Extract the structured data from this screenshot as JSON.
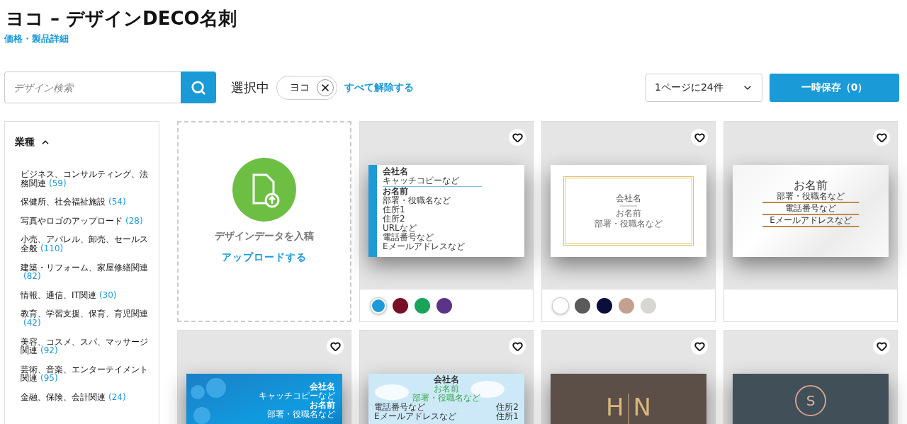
{
  "header": {
    "title": "ヨコ – デザインDECO名刺",
    "link": "価格・製品詳細"
  },
  "search": {
    "placeholder": "デザイン検索"
  },
  "filter": {
    "label": "選択中",
    "chips": [
      {
        "label": "ヨコ"
      }
    ],
    "clear_all": "すべて解除する"
  },
  "per_page": {
    "value": "1ページに24件"
  },
  "save_button": "一時保存（0）",
  "sidebar": {
    "heading": "業種",
    "expanded": true,
    "items": [
      {
        "label": "ビジネス、コンサルティング、法務関連",
        "count": "(59)"
      },
      {
        "label": "保健所、社会福祉施設",
        "count": "(54)"
      },
      {
        "label": "写真やロゴのアップロード",
        "count": "(28)"
      },
      {
        "label": "小売、アパレル、卸売、セールス全般",
        "count": "(110)"
      },
      {
        "label": "建築・リフォーム、家屋修繕関連",
        "count": "(82)"
      },
      {
        "label": "情報、通信、IT関連",
        "count": "(30)"
      },
      {
        "label": "教育、学習支援、保育、育児関連",
        "count": "(42)"
      },
      {
        "label": "美容、コスメ、スパ、マッサージ関連",
        "count": "(92)"
      },
      {
        "label": "芸術、音楽、エンターテイメント関連",
        "count": "(95)"
      },
      {
        "label": "金融、保険、会計関連",
        "count": "(24)"
      }
    ]
  },
  "upload_tile": {
    "caption": "デザインデータを入稿",
    "link": "アップロードする"
  },
  "templates": [
    {
      "kind": "stripe",
      "lines": [
        "会社名",
        "キャッチコピーなど",
        "お名前",
        "部署・役職名など",
        "住所1",
        "住所2",
        "URLなど",
        "電話番号など",
        "Eメールアドレスなど"
      ],
      "swatches": [
        {
          "color": "#1e9ad6",
          "selected": true
        },
        {
          "color": "#7a0e26",
          "selected": false
        },
        {
          "color": "#1aa35a",
          "selected": false
        },
        {
          "color": "#5b3487",
          "selected": false
        }
      ]
    },
    {
      "kind": "frame",
      "lines": [
        "会社名",
        "お名前",
        "部署・役職名など"
      ],
      "swatches": [
        {
          "color": "#ffffff",
          "selected": true
        },
        {
          "color": "#5a5a5a",
          "selected": false
        },
        {
          "color": "#0b0d3a",
          "selected": false
        },
        {
          "color": "#c4a18e",
          "selected": false
        },
        {
          "color": "#d8d6d0",
          "selected": false
        }
      ]
    },
    {
      "kind": "marble",
      "lines": [
        "お名前",
        "部署・役職名など",
        "電話番号など",
        "Eメールアドレスなど"
      ]
    },
    {
      "kind": "water",
      "lines": [
        "会社名",
        "キャッチコピーなど",
        "お名前",
        "部署・役職名など"
      ]
    },
    {
      "kind": "sky",
      "lines": [
        "会社名",
        "お名前",
        "部署・役職名など",
        "電話番号など",
        "Eメールアドレスなど",
        "住所2",
        "住所1"
      ]
    },
    {
      "kind": "monogram",
      "lines": [
        "H",
        "N"
      ]
    },
    {
      "kind": "emblem",
      "lines": [
        "S"
      ]
    }
  ]
}
